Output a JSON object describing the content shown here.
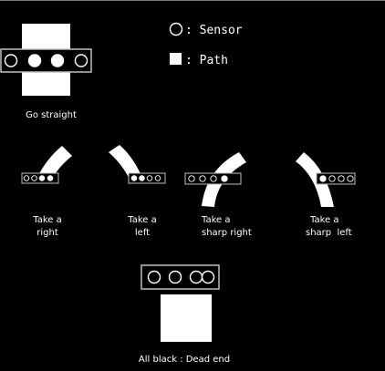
{
  "legend": {
    "sensor_label": ": Sensor",
    "path_label": ": Path",
    "sensor_icon": "circle-outline",
    "path_icon": "filled-square"
  },
  "cases": {
    "go_straight": {
      "caption": "Go straight",
      "sensors": [
        "off",
        "on",
        "on",
        "off"
      ]
    },
    "take_right": {
      "caption_line1": "Take a",
      "caption_line2": "right",
      "sensors": [
        "off",
        "off",
        "on",
        "on"
      ]
    },
    "take_left": {
      "caption_line1": "Take a",
      "caption_line2": "left",
      "sensors": [
        "on",
        "on",
        "off",
        "off"
      ]
    },
    "sharp_right": {
      "caption_line1": "Take a",
      "caption_line2": "sharp right",
      "sensors": [
        "off",
        "off",
        "off",
        "on"
      ]
    },
    "sharp_left": {
      "caption_line1": "Take a",
      "caption_line2": "sharp  left",
      "sensors": [
        "on",
        "off",
        "off",
        "off"
      ]
    },
    "dead_end": {
      "caption": "All black : Dead end",
      "sensors": [
        "off",
        "off",
        "off",
        "off"
      ]
    }
  },
  "colors": {
    "background": "#000000",
    "path": "#ffffff",
    "sensor_outline": "#ffffff",
    "sensor_box_border": "#bfbfbf",
    "text": "#ffffff"
  }
}
